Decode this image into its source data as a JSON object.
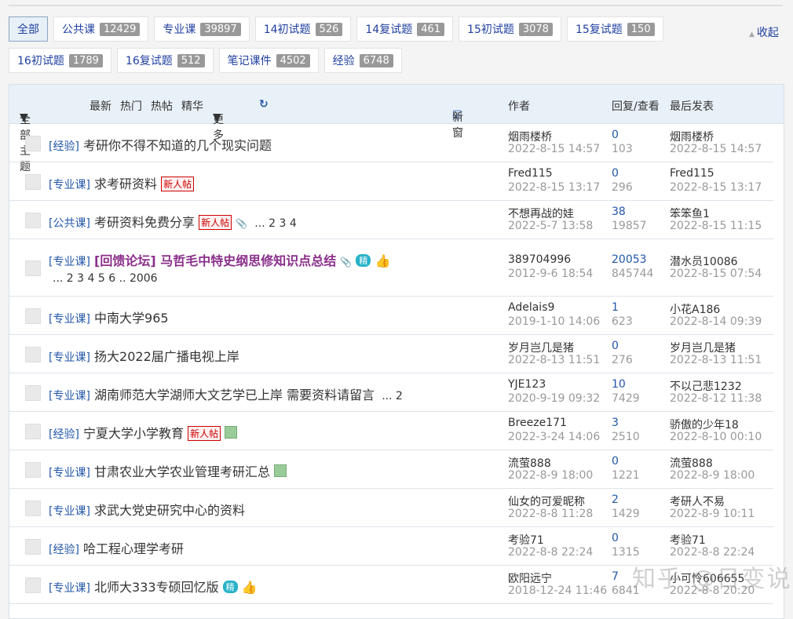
{
  "categories": [
    {
      "label": "全部",
      "count": null,
      "active": true
    },
    {
      "label": "公共课",
      "count": "12429"
    },
    {
      "label": "专业课",
      "count": "39897"
    },
    {
      "label": "14初试题",
      "count": "526"
    },
    {
      "label": "14复试题",
      "count": "461"
    },
    {
      "label": "15初试题",
      "count": "3078"
    },
    {
      "label": "15复试题",
      "count": "150"
    },
    {
      "label": "16初试题",
      "count": "1789"
    },
    {
      "label": "16复试题",
      "count": "512"
    },
    {
      "label": "笔记课件",
      "count": "4502"
    },
    {
      "label": "经验",
      "count": "6748"
    }
  ],
  "collapse_label": "收起",
  "header": {
    "all_topics": "全部主题",
    "latest": "最新",
    "hot": "热门",
    "hot_posts": "热帖",
    "digest": "精华",
    "more": "更多",
    "refresh_icon": "refresh-icon",
    "new_window": "新窗",
    "author": "作者",
    "reply_view": "回复/查看",
    "last_post": "最后发表"
  },
  "badges": {
    "new": "新人帖",
    "digest": "精"
  },
  "threads": [
    {
      "tag": "[经验]",
      "title": "考研你不得不知道的几个现实问题",
      "author": "烟雨楼桥",
      "date": "2022-8-15 14:57",
      "replies": "0",
      "views": "103",
      "last_user": "烟雨楼桥",
      "last_date": "2022-8-15 14:57"
    },
    {
      "tag": "[专业课]",
      "title": "求考研资料",
      "new": true,
      "author": "Fred115",
      "date": "2022-8-15 13:17",
      "replies": "0",
      "views": "296",
      "last_user": "Fred115",
      "last_date": "2022-8-15 13:17"
    },
    {
      "tag": "[公共课]",
      "title": "考研资料免费分享",
      "new": true,
      "attach": true,
      "pages": "... 2  3  4",
      "author": "不想再战的娃",
      "date": "2022-5-7 13:58",
      "replies": "38",
      "views": "19857",
      "last_user": "笨笨鱼1",
      "last_date": "2022-8-15 11:15"
    },
    {
      "tag": "[专业课]",
      "title": "[回馈论坛] 马哲毛中特史纲思修知识点总结",
      "highlight": true,
      "attach": true,
      "digest": true,
      "thumb": true,
      "pages2": "... 2  3  4  5  6 .. 2006",
      "author": "389704996",
      "date": "2012-9-6 18:54",
      "replies": "20053",
      "views": "845744",
      "last_user": "潜水员10086",
      "last_date": "2022-8-15 07:54"
    },
    {
      "tag": "[专业课]",
      "title": "中南大学965",
      "author": "Adelais9",
      "date": "2019-1-10 14:06",
      "replies": "1",
      "views": "623",
      "last_user": "小花A186",
      "last_date": "2022-8-14 09:39"
    },
    {
      "tag": "[专业课]",
      "title": "扬大2022届广播电视上岸",
      "author": "岁月岂几是猪",
      "date": "2022-8-13 11:51",
      "replies": "0",
      "views": "276",
      "last_user": "岁月岂几是猪",
      "last_date": "2022-8-13 11:51"
    },
    {
      "tag": "[专业课]",
      "title": "湖南师范大学湖师大文艺学已上岸 需要资料请留言",
      "pages": "... 2",
      "author": "YJE123",
      "date": "2020-9-19 09:32",
      "replies": "10",
      "views": "7429",
      "last_user": "不以己悲1232",
      "last_date": "2022-8-12 11:38"
    },
    {
      "tag": "[经验]",
      "title": "宁夏大学小学教育",
      "new": true,
      "image": true,
      "author": "Breeze171",
      "date": "2022-3-24 14:06",
      "replies": "3",
      "views": "2510",
      "last_user": "骄傲的少年18",
      "last_date": "2022-8-10 00:10"
    },
    {
      "tag": "[专业课]",
      "title": "甘肃农业大学农业管理考研汇总",
      "image": true,
      "author": "流萤888",
      "date": "2022-8-9 18:00",
      "replies": "0",
      "views": "1221",
      "last_user": "流萤888",
      "last_date": "2022-8-9 18:00"
    },
    {
      "tag": "[专业课]",
      "title": "求武大党史研究中心的资料",
      "author": "仙女的可爱昵称",
      "date": "2022-8-8 11:28",
      "replies": "2",
      "views": "1429",
      "last_user": "考研人不易",
      "last_date": "2022-8-9 10:11"
    },
    {
      "tag": "[经验]",
      "title": "哈工程心理学考研",
      "author": "考验71",
      "date": "2022-8-8 22:24",
      "replies": "0",
      "views": "1315",
      "last_user": "考验71",
      "last_date": "2022-8-8 22:24"
    },
    {
      "tag": "[专业课]",
      "title": "北师大333专硕回忆版",
      "digest": true,
      "thumb": true,
      "author": "欧阳远宁",
      "date": "2018-12-24 11:46",
      "replies": "7",
      "views": "6841",
      "last_user": "小可怜606655",
      "last_date": "2022-8-8 20:20"
    }
  ],
  "watermark": "知乎 @日变说"
}
